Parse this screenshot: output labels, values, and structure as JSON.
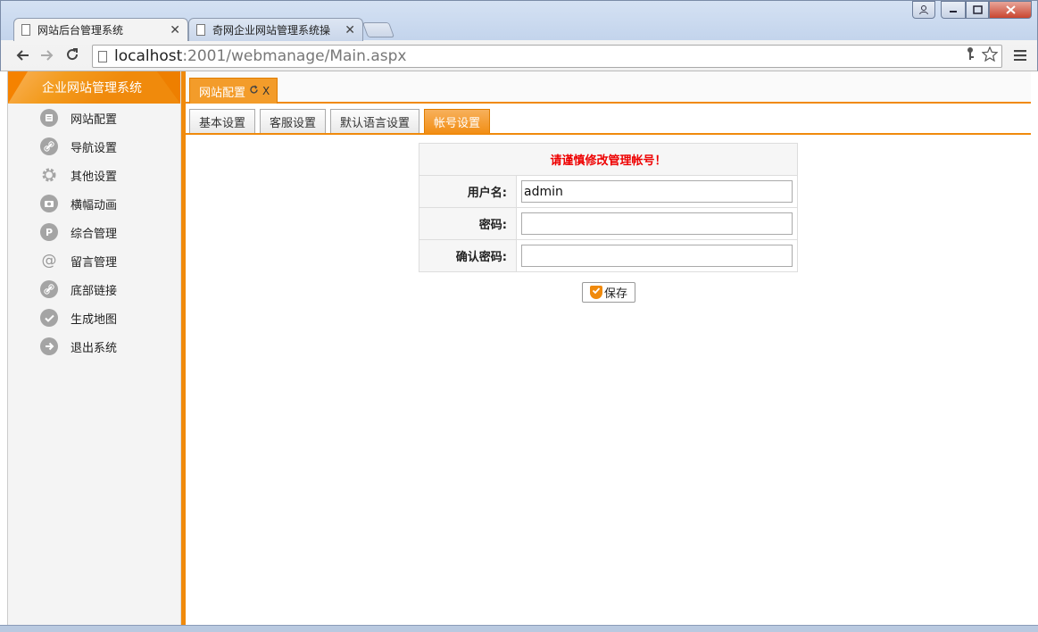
{
  "browser": {
    "tabs": [
      {
        "title": "网站后台管理系统",
        "active": true
      },
      {
        "title": "奇网企业网站管理系统操",
        "active": false
      }
    ],
    "url_host": "localhost",
    "url_path": ":2001/webmanage/Main.aspx",
    "close_glyph": "✕"
  },
  "sidebar": {
    "title": "企业网站管理系统",
    "items": [
      {
        "label": "网站配置",
        "icon": "list-icon"
      },
      {
        "label": "导航设置",
        "icon": "link-icon"
      },
      {
        "label": "其他设置",
        "icon": "gear-icon"
      },
      {
        "label": "横幅动画",
        "icon": "camera-icon"
      },
      {
        "label": "综合管理",
        "icon": "p-icon"
      },
      {
        "label": "留言管理",
        "icon": "at-icon"
      },
      {
        "label": "底部链接",
        "icon": "link-icon"
      },
      {
        "label": "生成地图",
        "icon": "check-icon"
      },
      {
        "label": "退出系统",
        "icon": "arrow-right-icon"
      }
    ]
  },
  "main": {
    "open_tab": {
      "label": "网站配置",
      "close": "X"
    },
    "subtabs": [
      {
        "label": "基本设置",
        "active": false
      },
      {
        "label": "客服设置",
        "active": false
      },
      {
        "label": "默认语言设置",
        "active": false
      },
      {
        "label": "帐号设置",
        "active": true
      }
    ],
    "form": {
      "warning": "请谨慎修改管理帐号！",
      "username_label": "用户名:",
      "username_value": "admin",
      "password_label": "密码:",
      "password_value": "",
      "confirm_label": "确认密码:",
      "confirm_value": "",
      "save_label": "保存"
    }
  },
  "colors": {
    "accent": "#f08a0c",
    "warning_text": "#ee0000"
  }
}
